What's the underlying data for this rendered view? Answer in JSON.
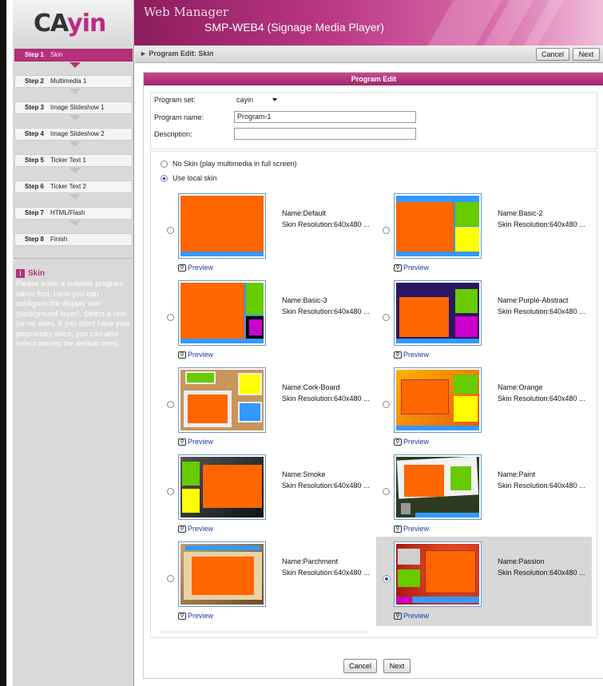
{
  "header": {
    "logo_left": "CA",
    "logo_right": "yin",
    "app_title": "Web Manager",
    "model": "SMP-WEB4 (Signage Media Player)"
  },
  "sidebar": {
    "steps": [
      {
        "num": "Step 1",
        "label": "Skin"
      },
      {
        "num": "Step 2",
        "label": "Multimedia 1"
      },
      {
        "num": "Step 3",
        "label": "Image Slideshow 1"
      },
      {
        "num": "Step 4",
        "label": "Image Slideshow 2"
      },
      {
        "num": "Step 5",
        "label": "Ticker Text 1"
      },
      {
        "num": "Step 6",
        "label": "Ticker Text 2"
      },
      {
        "num": "Step 7",
        "label": "HTML/Flash"
      },
      {
        "num": "Step 8",
        "label": "Finish"
      }
    ],
    "help_title": "Skin",
    "help_text": "Please enter a suitable program name first. Here you can configure the display skin (background layer). Select a skin (or no skin). If you don't have your proprietary skins, you can also select among the default ones."
  },
  "toolbar": {
    "breadcrumb": "► Program Edit: Skin",
    "cancel": "Cancel",
    "next": "Next"
  },
  "panel": {
    "title": "Program Edit",
    "program_set_label": "Program set:",
    "program_set_value": "cayin",
    "program_name_label": "Program name:",
    "program_name_value": "Program-1",
    "description_label": "Description:",
    "description_value": "",
    "no_skin": "No Skin (play multimedia in full screen)",
    "use_local": "Use local skin",
    "preview": "Preview",
    "skins": [
      {
        "name": "Name:Default",
        "res": "Skin Resolution:640x480 ..."
      },
      {
        "name": "Name:Basic-2",
        "res": "Skin Resolution:640x480 ..."
      },
      {
        "name": "Name:Basic-3",
        "res": "Skin Resolution:640x480 ..."
      },
      {
        "name": "Name:Purple-Abstract",
        "res": "Skin Resolution:640x480 ..."
      },
      {
        "name": "Name:Cork-Board",
        "res": "Skin Resolution:640x480 ..."
      },
      {
        "name": "Name:Orange",
        "res": "Skin Resolution:640x480 ..."
      },
      {
        "name": "Name:Smoke",
        "res": "Skin Resolution:640x480 ..."
      },
      {
        "name": "Name:Paint",
        "res": "Skin Resolution:640x480 ..."
      },
      {
        "name": "Name:Parchment",
        "res": "Skin Resolution:640x480 ..."
      },
      {
        "name": "Name:Passion",
        "res": "Skin Resolution:640x480 ..."
      }
    ],
    "cancel": "Cancel",
    "next": "Next"
  },
  "colors": {
    "brand": "#b4307a",
    "skin_orange": "#ff6600",
    "skin_green": "#66cc00",
    "skin_yellow": "#ffff00",
    "skin_blue": "#3399ff"
  }
}
